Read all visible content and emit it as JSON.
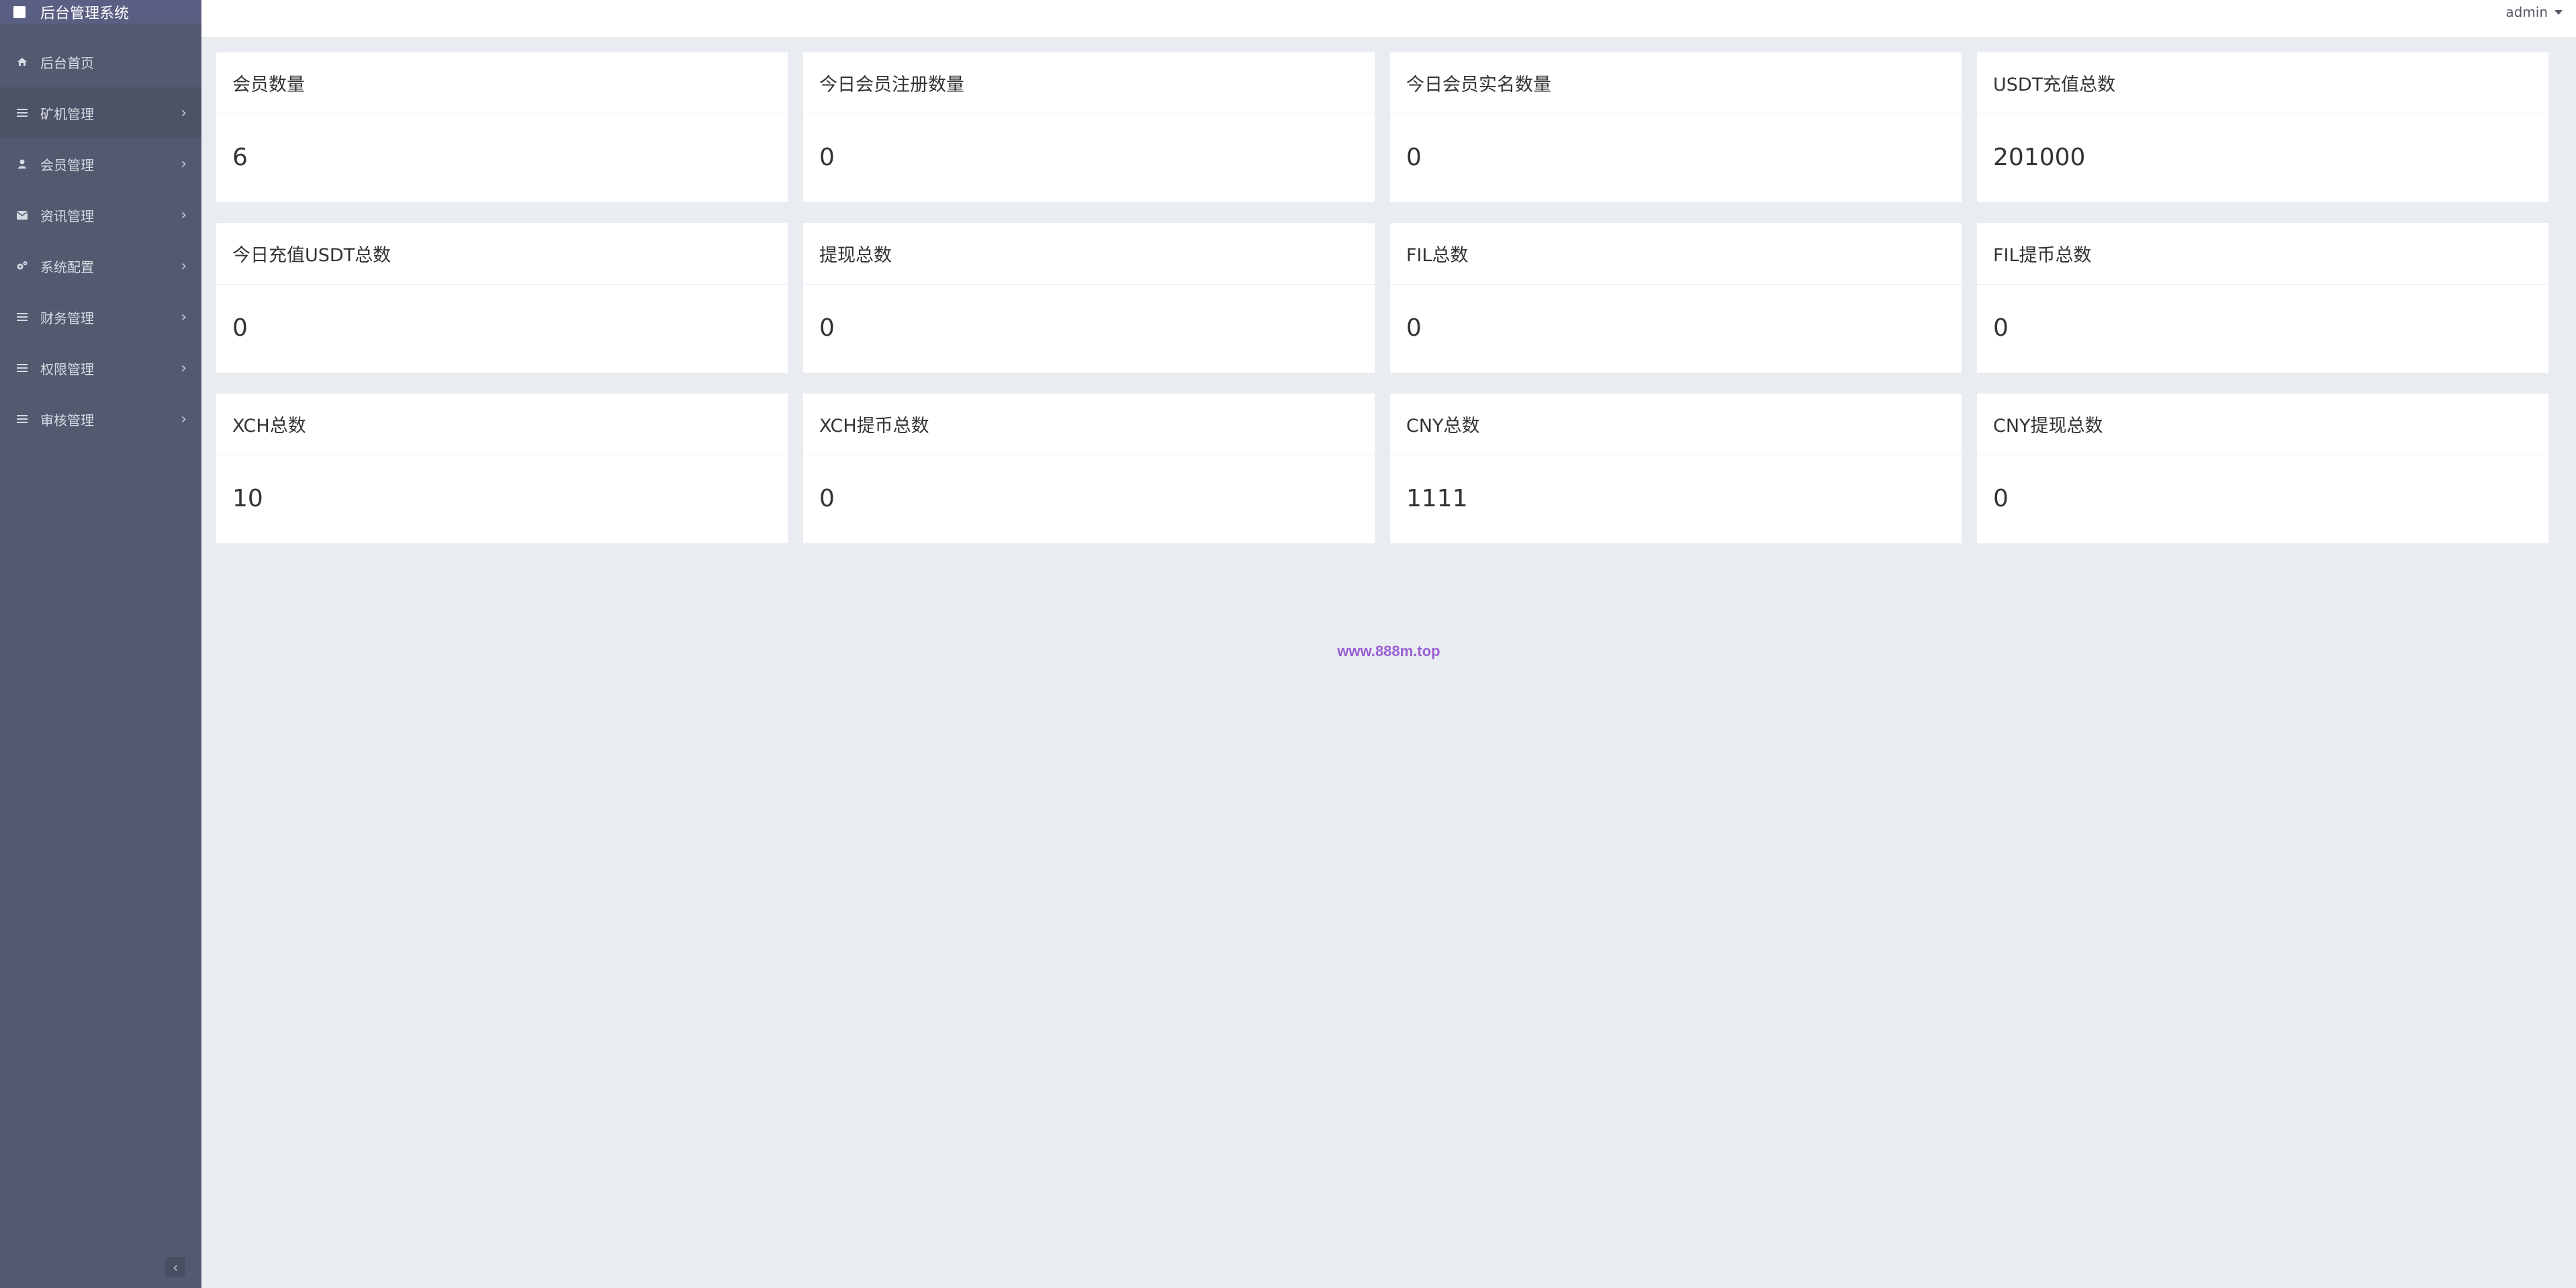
{
  "brand": {
    "title": "后台管理系统"
  },
  "topbar": {
    "user": "admin"
  },
  "sidebar": {
    "items": [
      {
        "label": "后台首页",
        "icon": "home-icon",
        "chevron": false
      },
      {
        "label": "矿机管理",
        "icon": "list-icon",
        "chevron": true
      },
      {
        "label": "会员管理",
        "icon": "user-icon",
        "chevron": true
      },
      {
        "label": "资讯管理",
        "icon": "envelope-icon",
        "chevron": true
      },
      {
        "label": "系统配置",
        "icon": "gears-icon",
        "chevron": true
      },
      {
        "label": "财务管理",
        "icon": "list-icon",
        "chevron": true
      },
      {
        "label": "权限管理",
        "icon": "list-icon",
        "chevron": true
      },
      {
        "label": "审核管理",
        "icon": "list-icon",
        "chevron": true
      }
    ],
    "collapse_glyph": "‹"
  },
  "stats": [
    {
      "title": "会员数量",
      "value": "6"
    },
    {
      "title": "今日会员注册数量",
      "value": "0"
    },
    {
      "title": "今日会员实名数量",
      "value": "0"
    },
    {
      "title": "USDT充值总数",
      "value": "201000"
    },
    {
      "title": "今日充值USDT总数",
      "value": "0"
    },
    {
      "title": "提现总数",
      "value": "0"
    },
    {
      "title": "FIL总数",
      "value": "0"
    },
    {
      "title": "FIL提币总数",
      "value": "0"
    },
    {
      "title": "XCH总数",
      "value": "10"
    },
    {
      "title": "XCH提币总数",
      "value": "0"
    },
    {
      "title": "CNY总数",
      "value": "1111"
    },
    {
      "title": "CNY提现总数",
      "value": "0"
    }
  ],
  "footer": {
    "link": "www.888m.top"
  },
  "colors": {
    "sidebar_bg": "#535a6f",
    "brand_bg": "#5c5f84",
    "content_bg": "#e9edf1",
    "footer_link": "#9a5fd0"
  }
}
